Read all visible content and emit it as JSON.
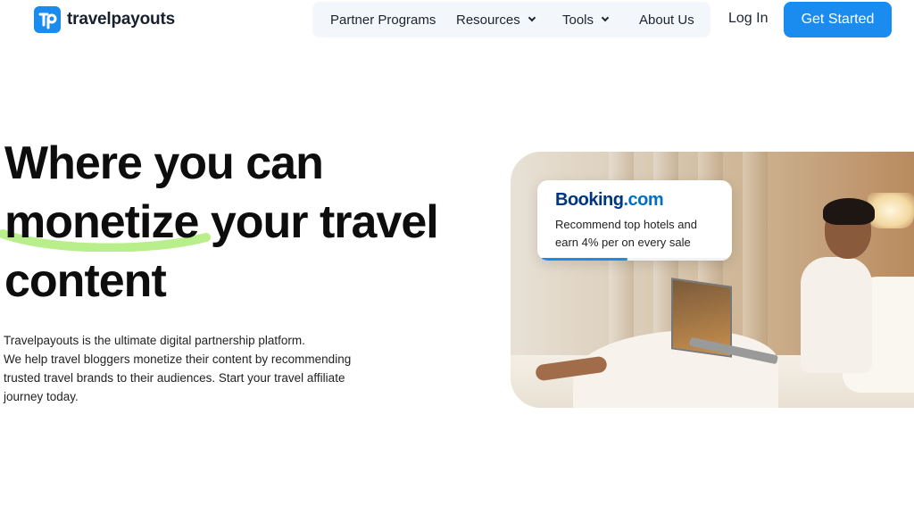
{
  "brand": {
    "name": "travelpayouts",
    "logo_icon": "tp-logo-icon",
    "accent": "#1a8cf0"
  },
  "nav": {
    "items": [
      {
        "label": "Partner Programs",
        "has_dropdown": false
      },
      {
        "label": "Resources",
        "has_dropdown": true
      },
      {
        "label": "Tools",
        "has_dropdown": true
      },
      {
        "label": "About Us",
        "has_dropdown": false
      }
    ],
    "login_label": "Log In",
    "cta_label": "Get Started"
  },
  "hero": {
    "headline_line1": "Where you can",
    "headline_highlight": "monetize",
    "headline_line2_rest": " your travel",
    "headline_line3": "content",
    "highlight_color": "#b9ef8a",
    "description_lines": [
      "Travelpayouts is the ultimate digital partnership platform.",
      "We help travel bloggers monetize their content by recommending",
      "trusted travel brands to their audiences. Start your travel affiliate",
      "journey today."
    ]
  },
  "card": {
    "logo_main": "Booking",
    "logo_suffix": ".com",
    "text_lines": [
      "Recommend top hotels and",
      "earn 4% per on every sale"
    ],
    "progress_fraction": 0.46
  }
}
